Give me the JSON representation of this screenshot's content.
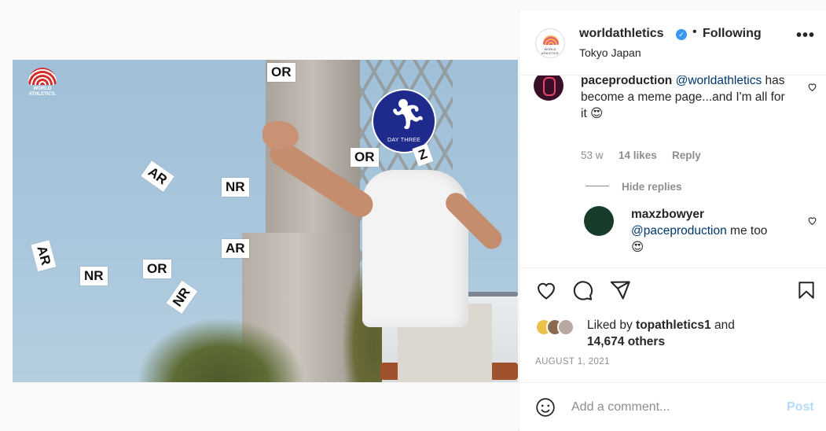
{
  "media": {
    "logo_text": "WORLD ATHLETICS.",
    "badge_text": "DAY THREE",
    "tags": [
      "OR",
      "OR",
      "AR",
      "NR",
      "AR",
      "NR",
      "OR",
      "AR",
      "NR",
      "Ζ"
    ]
  },
  "header": {
    "username": "worldathletics",
    "separator": "•",
    "follow_status": "Following",
    "location": "Tokyo Japan",
    "more": "•••"
  },
  "comments": [
    {
      "username": "paceproduction",
      "mention": "@worldathletics",
      "text": "has become a meme page...and I'm all for it 😍",
      "age": "53 w",
      "likes": "14 likes",
      "reply": "Reply"
    }
  ],
  "hide_replies": "Hide replies",
  "reply": {
    "username": "maxzbowyer",
    "mention": "@paceproduction",
    "text": "me too",
    "emoji": "😍"
  },
  "likes": {
    "prefix": "Liked by",
    "user": "topathletics1",
    "suffix": "and",
    "others": "14,674 others"
  },
  "date": "AUGUST 1, 2021",
  "add_comment": {
    "placeholder": "Add a comment...",
    "post_label": "Post"
  },
  "colors": {
    "verified": "#3897f0",
    "mention": "#00376b",
    "post_disabled": "#b3dbff",
    "badge": "#1e2a8c"
  }
}
